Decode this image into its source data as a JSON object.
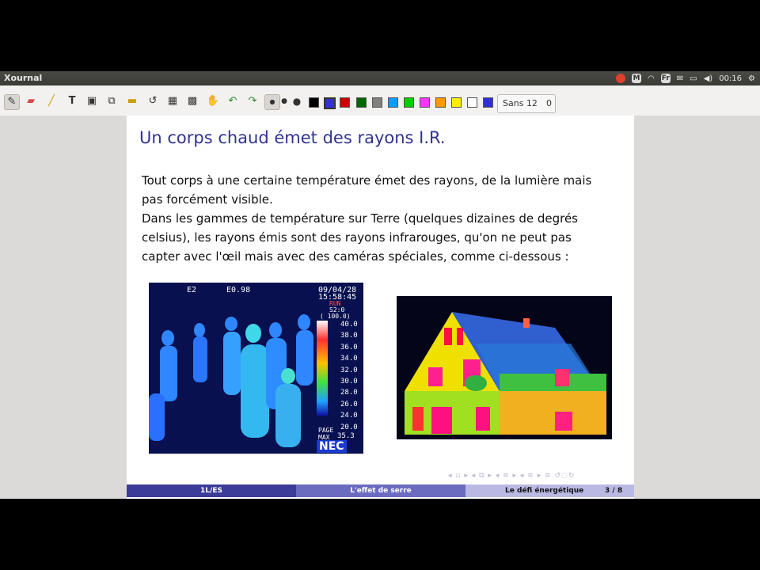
{
  "window": {
    "title": "Xournal"
  },
  "tray": {
    "clock": "00:16",
    "lang": "Fr",
    "mail": "M"
  },
  "toolbar": {
    "tools": [
      "pen-icon",
      "eraser-icon",
      "highlighter-icon",
      "text-icon",
      "image-icon",
      "shape-icon",
      "ruler-icon",
      "lasso-icon",
      "select-region-icon",
      "hand-icon",
      "undo-icon",
      "redo-icon"
    ],
    "thickness": [
      "thin",
      "medium",
      "thick"
    ],
    "colors": [
      "#000000",
      "#3333cc",
      "#cc0000",
      "#006600",
      "#808080",
      "#00a0ff",
      "#00cc00",
      "#ff33ff",
      "#ff9900",
      "#ffee00",
      "#ffffff",
      "#3030d0"
    ],
    "font_name": "Sans 12",
    "font_extra": "0"
  },
  "slide": {
    "title": "Un corps chaud émet des rayons I.R.",
    "lines": [
      "Tout corps à une certaine température émet des rayons, de la lumière mais",
      "pas forcément visible.",
      "Dans les gammes de température sur Terre (quelques dizaines de degrés",
      "celsius), les rayons émis sont des rayons infrarouges, qu'on ne peut pas",
      "capter avec l'œil mais avec des caméras spéciales, comme ci-dessous :"
    ],
    "thermal_people": {
      "top_left": "E2",
      "emissivity": "E0.98",
      "date": "09/04/28",
      "time": "15:58:45",
      "mode1": "RUN",
      "mode2": "S2:0",
      "range": "( 100.0)",
      "scale": [
        "40.0",
        "38.0",
        "36.0",
        "34.0",
        "32.0",
        "30.0",
        "28.0",
        "26.0",
        "24.0",
        "20.0"
      ],
      "page": "PAGE",
      "max_label": "MAX",
      "max_value": "35.3",
      "brand": "NEC"
    },
    "footer": {
      "left": "1L/ES",
      "center": "L'effet de serre",
      "right": "Le défi énergétique",
      "page": "3 / 8"
    },
    "nav_symbols": "◂ ▫ ▸ ◂ ⧉ ▸ ◂ ≡ ▸ ◂ ≡ ▸ ≡ ↺◌↻"
  }
}
